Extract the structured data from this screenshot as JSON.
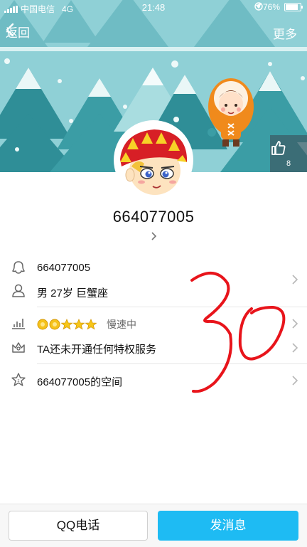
{
  "status_bar": {
    "carrier": "中国电信",
    "network": "4G",
    "time": "21:48",
    "battery": "76%",
    "battery_level": 0.76
  },
  "nav": {
    "back_label": "返回",
    "more_label": "更多"
  },
  "like": {
    "count": "8"
  },
  "profile": {
    "nickname": "664077005"
  },
  "info_rows": [
    {
      "icon": "qq-penguin-icon",
      "text": "664077005"
    },
    {
      "icon": "person-icon",
      "text": "男 27岁 巨蟹座"
    },
    {
      "icon": "level-chart-icon",
      "stars": 5,
      "level_label": "慢速中"
    },
    {
      "icon": "privilege-crown-icon",
      "text": "TA还未开通任何特权服务"
    },
    {
      "icon": "space-star-icon",
      "text": "664077005的空间"
    }
  ],
  "annotation": "30",
  "bottom": {
    "call_label": "QQ电话",
    "message_label": "发消息"
  },
  "colors": {
    "banner_bg": "#8fd0d6",
    "accent_blue": "#1ebbf3",
    "annotation_red": "#e8141b"
  }
}
